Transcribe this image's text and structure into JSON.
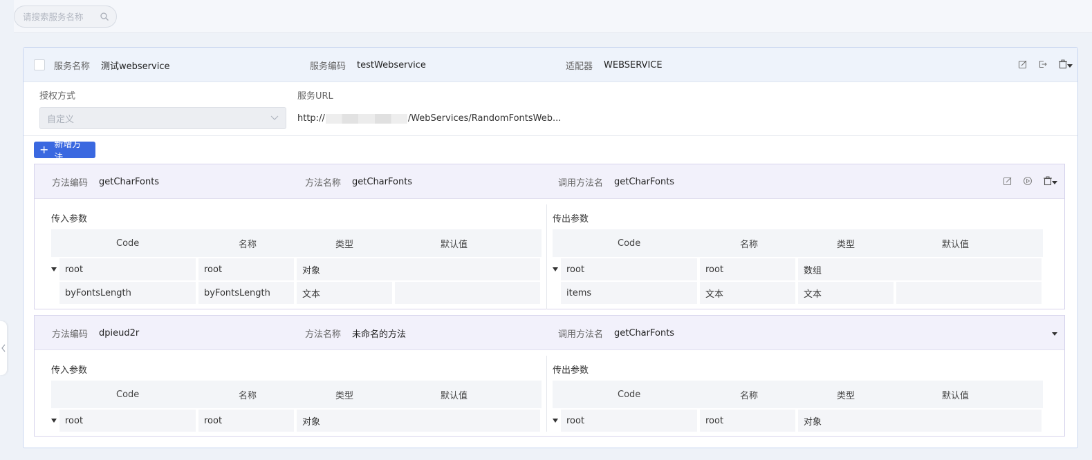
{
  "search": {
    "placeholder": "请搜索服务名称",
    "icon": "search-icon"
  },
  "service": {
    "name_label": "服务名称",
    "name_value": "测试webservice",
    "code_label": "服务编码",
    "code_value": "testWebservice",
    "adapter_label": "适配器",
    "adapter_value": "WEBSERVICE",
    "auth_label": "授权方式",
    "auth_value": "自定义",
    "url_label": "服务URL",
    "url_prefix": "http://",
    "url_suffix": "/WebServices/RandomFontsWeb...",
    "add_method_label": "新增方法"
  },
  "methods": [
    {
      "code_label": "方法编码",
      "code_value": "getCharFonts",
      "name_label": "方法名称",
      "name_value": "getCharFonts",
      "call_label": "调用方法名",
      "call_value": "getCharFonts",
      "input_title": "传入参数",
      "output_title": "传出参数",
      "headers": [
        "Code",
        "名称",
        "类型",
        "默认值"
      ],
      "inputs": [
        {
          "code": "root",
          "name": "root",
          "type": "对象",
          "default": ""
        },
        {
          "code": "byFontsLength",
          "name": "byFontsLength",
          "type": "文本",
          "default": ""
        }
      ],
      "outputs": [
        {
          "code": "root",
          "name": "root",
          "type": "数组",
          "default": ""
        },
        {
          "code": "items",
          "name": "文本",
          "type": "文本",
          "default": ""
        }
      ]
    },
    {
      "code_label": "方法编码",
      "code_value": "dpieud2r",
      "name_label": "方法名称",
      "name_value": "未命名的方法",
      "call_label": "调用方法名",
      "call_value": "getCharFonts",
      "input_title": "传入参数",
      "output_title": "传出参数",
      "headers": [
        "Code",
        "名称",
        "类型",
        "默认值"
      ],
      "inputs": [
        {
          "code": "root",
          "name": "root",
          "type": "对象",
          "default": ""
        }
      ],
      "outputs": [
        {
          "code": "root",
          "name": "root",
          "type": "对象",
          "default": ""
        }
      ]
    }
  ],
  "colors": {
    "accent": "#3a68e0",
    "service_header": "#eef3fb",
    "method_header": "#f2f1fb"
  }
}
